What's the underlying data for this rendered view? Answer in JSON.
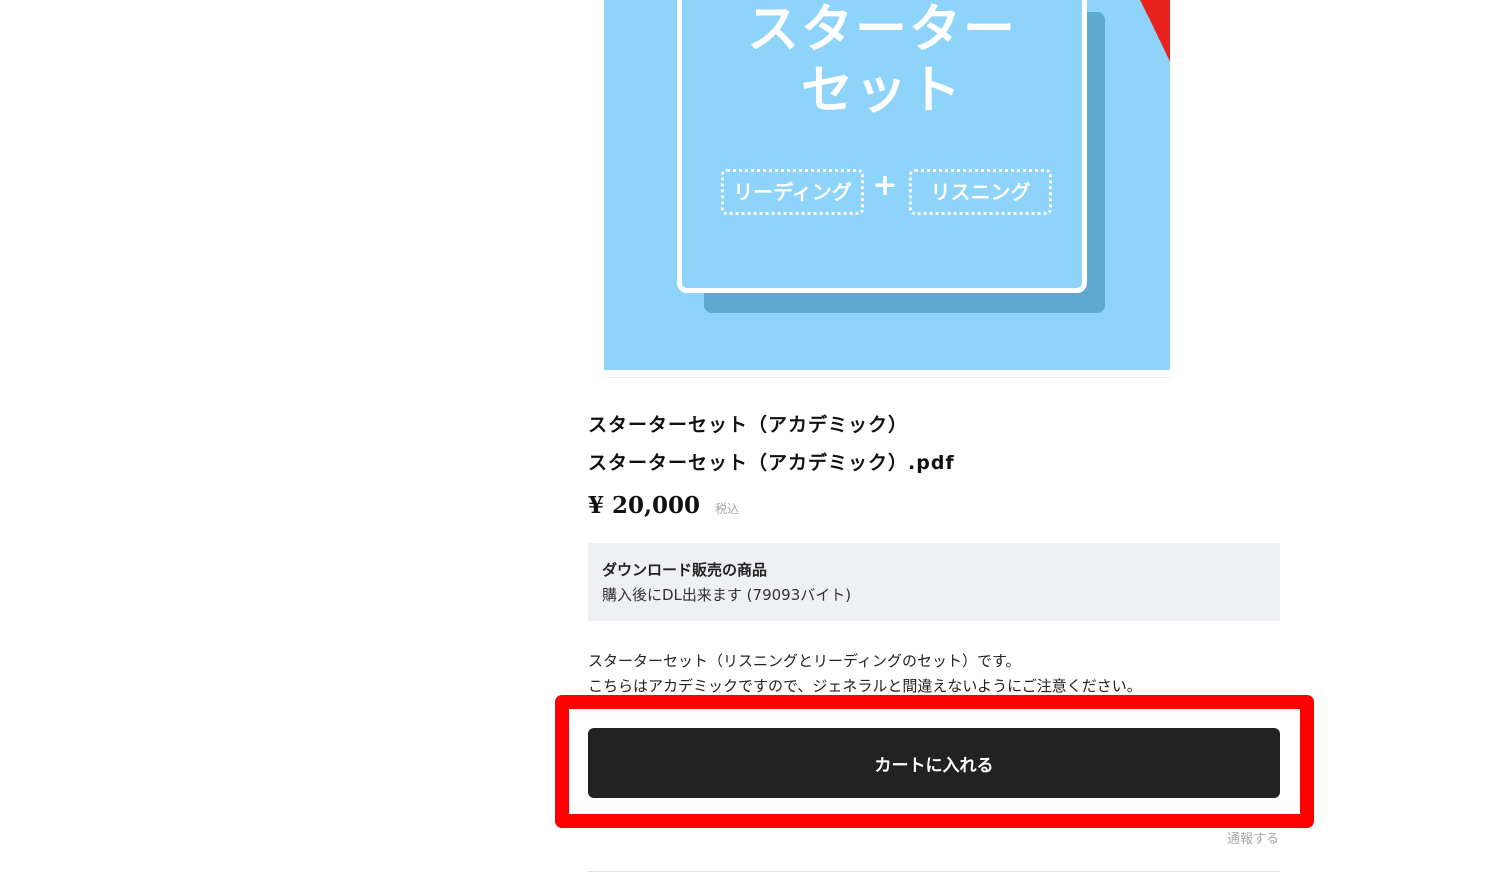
{
  "product_image": {
    "cover_title_line1": "スターター",
    "cover_title_line2": "セット",
    "pill_reading": "リーディング",
    "pill_plus": "+",
    "pill_listening": "リスニング"
  },
  "product": {
    "title": "スターターセット（アカデミック）",
    "file_name": "スターターセット（アカデミック）.pdf",
    "price": "¥ 20,000",
    "tax_label": "税込"
  },
  "download_info": {
    "heading": "ダウンロード販売の商品",
    "note": "購入後にDL出来ます (79093バイト)"
  },
  "description": {
    "line1": "スターターセット（リスニングとリーディングのセット）です。",
    "line2": "こちらはアカデミックですので、ジェネラルと間違えないようにご注意ください。"
  },
  "actions": {
    "add_to_cart": "カートに入れる",
    "report": "通報する"
  },
  "colors": {
    "image_bg": "#8dd3fa",
    "button_bg": "#222222",
    "highlight": "#ff0000"
  }
}
